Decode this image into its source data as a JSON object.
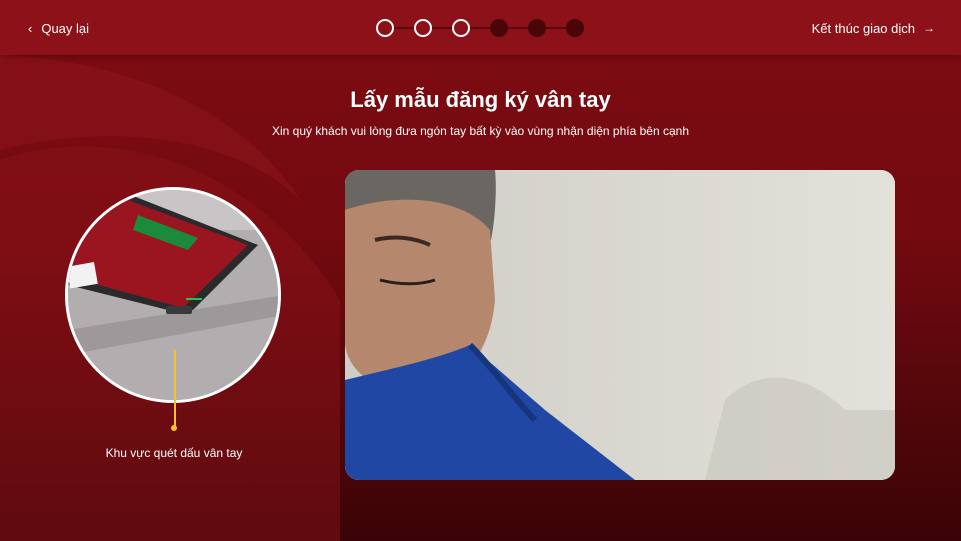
{
  "header": {
    "back_label": "Quay lại",
    "end_label": "Kết thúc giao dịch",
    "steps": [
      {
        "state": "done"
      },
      {
        "state": "done"
      },
      {
        "state": "done"
      },
      {
        "state": "todo"
      },
      {
        "state": "todo"
      },
      {
        "state": "todo"
      }
    ]
  },
  "main": {
    "title": "Lấy mẫu đăng ký vân tay",
    "subtitle": "Xin quý khách vui lòng đưa ngón tay bất kỳ vào vùng nhận diện phía bên cạnh"
  },
  "scanner": {
    "label": "Khu vực quét dấu vân tay"
  },
  "colors": {
    "brand_red": "#8c1119",
    "accent_yellow": "#f3c131",
    "step_inactive": "#4a0508"
  },
  "icons": [
    "chevron-left-icon",
    "arrow-right-icon"
  ]
}
